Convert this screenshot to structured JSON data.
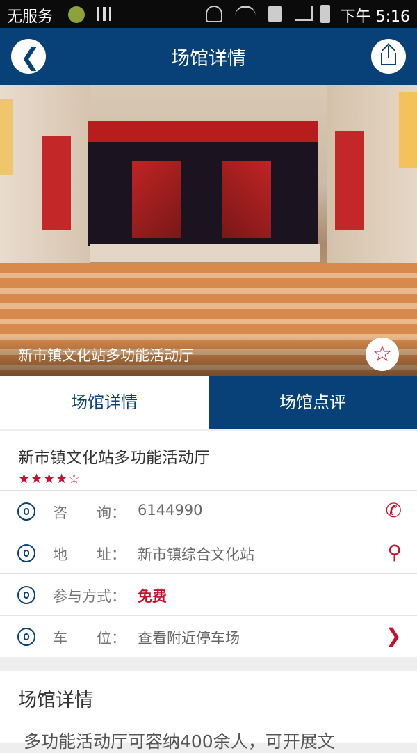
{
  "status_bar": {
    "carrier": "无服务",
    "time": "下午 5:16",
    "icons": [
      "sim-icon",
      "signal-bars-icon",
      "mute-icon",
      "wifi-icon",
      "question-signal-icon",
      "cell-signal-icon",
      "battery-icon"
    ]
  },
  "nav": {
    "title": "场馆详情",
    "back_icon": "chevron-left-icon",
    "share_icon": "share-icon"
  },
  "hero": {
    "caption": "新市镇文化站多功能活动厅",
    "favorite_icon": "star-outline-icon"
  },
  "tabs": [
    {
      "label": "场馆详情",
      "active": true
    },
    {
      "label": "场馆点评",
      "active": false
    }
  ],
  "venue": {
    "name": "新市镇文化站多功能活动厅",
    "stars_text": "★★★★☆",
    "rating": 4,
    "rating_max": 5
  },
  "rows": [
    {
      "icon": "phone-icon",
      "label": "咨　　询：",
      "value": "6144990",
      "action_icon": "phone-call-icon"
    },
    {
      "icon": "location-icon",
      "label": "地　　址：",
      "value": "新市镇综合文化站",
      "action_icon": "map-pin-icon"
    },
    {
      "icon": "coins-icon",
      "label": "参与方式：",
      "value": "免费"
    },
    {
      "icon": "car-icon",
      "label": "车　　位：",
      "value": "查看附近停车场",
      "action_icon": "chevron-right-icon"
    }
  ],
  "detail": {
    "heading": "场馆详情",
    "body": "多功能活动厅可容纳400余人，可开展文"
  },
  "colors": {
    "primary": "#084178",
    "accent": "#c8102e",
    "background": "#eeeeee"
  }
}
